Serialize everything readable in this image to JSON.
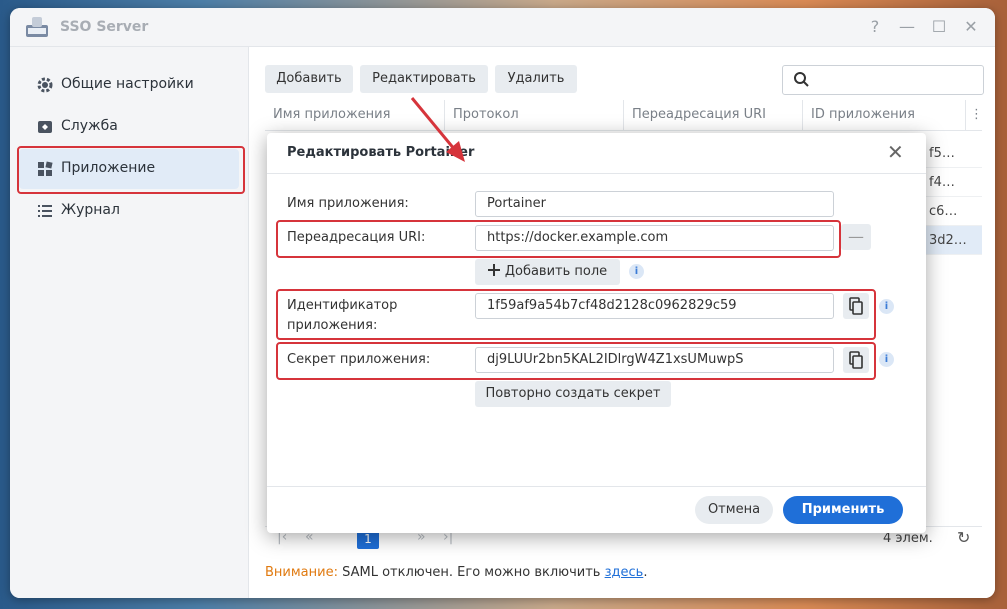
{
  "window": {
    "title": "SSO Server",
    "help": "?",
    "minimize": "—",
    "maximize": "☐",
    "close": "✕"
  },
  "sidebar": {
    "items": [
      {
        "label": "Общие настройки",
        "icon": "gear-icon"
      },
      {
        "label": "Служба",
        "icon": "service-icon"
      },
      {
        "label": "Приложение",
        "icon": "apps-grid-icon"
      },
      {
        "label": "Журнал",
        "icon": "list-icon"
      }
    ]
  },
  "toolbar": {
    "add": "Добавить",
    "edit": "Редактировать",
    "delete": "Удалить"
  },
  "table": {
    "columns": [
      "Имя приложения",
      "Протокол",
      "Переадресация URI",
      "ID приложения",
      "⋮"
    ],
    "rows_visible_id": [
      "f5…",
      "f4…",
      "c6…",
      "3d2…"
    ]
  },
  "pager": {
    "first": "|‹",
    "prev": "«",
    "current": "1",
    "next": "»",
    "last": "›|",
    "count": "4 элем.",
    "refresh": "↻"
  },
  "notice": {
    "label": "Внимание:",
    "text": " SAML отключен. Его можно включить ",
    "link": "здесь",
    "end": "."
  },
  "dialog": {
    "title": "Редактировать Portainer",
    "close": "✕",
    "fields": {
      "app_name_label": "Имя приложения:",
      "app_name_value": "Portainer",
      "redirect_label": "Переадресация URI:",
      "redirect_value": "https://docker.example.com",
      "add_field": "Добавить поле",
      "app_id_label": "Идентификатор приложения:",
      "app_id_value": "1f59af9a54b7cf48d2128c0962829c59",
      "secret_label": "Секрет приложения:",
      "secret_value": "dj9LUUr2bn5KAL2IDlrgW4Z1xsUMuwpS",
      "regen": "Повторно создать секрет"
    },
    "info": "i",
    "cancel": "Отмена",
    "apply": "Применить"
  },
  "colors": {
    "accent": "#1f6fd8",
    "highlight": "#d6343b",
    "warning": "#e07a10"
  }
}
